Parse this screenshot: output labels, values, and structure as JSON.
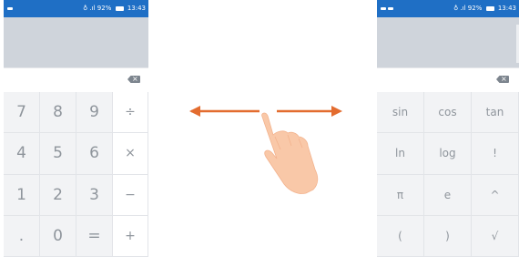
{
  "status_bar": {
    "left_indicator": "▭",
    "icons": "♁ .ıl",
    "battery_percent": "92%",
    "time": "13:43"
  },
  "left_keypad": {
    "keys": [
      "7",
      "8",
      "9",
      "÷",
      "4",
      "5",
      "6",
      "×",
      "1",
      "2",
      "3",
      "−",
      ".",
      "0",
      "=",
      "+"
    ]
  },
  "right_keypad": {
    "keys": [
      "sin",
      "cos",
      "tan",
      "ln",
      "log",
      "!",
      "π",
      "e",
      "^",
      "(",
      ")",
      "√"
    ]
  },
  "gesture": {
    "icons": [
      "arrow-left-icon",
      "arrow-right-icon",
      "hand-swipe-icon"
    ],
    "arrow_color": "#e36c2f",
    "hand_color": "#f9c8a8"
  },
  "colors": {
    "status_bar": "#1f6fc5",
    "display": "#cfd4db",
    "keypad": "#f2f3f5"
  }
}
